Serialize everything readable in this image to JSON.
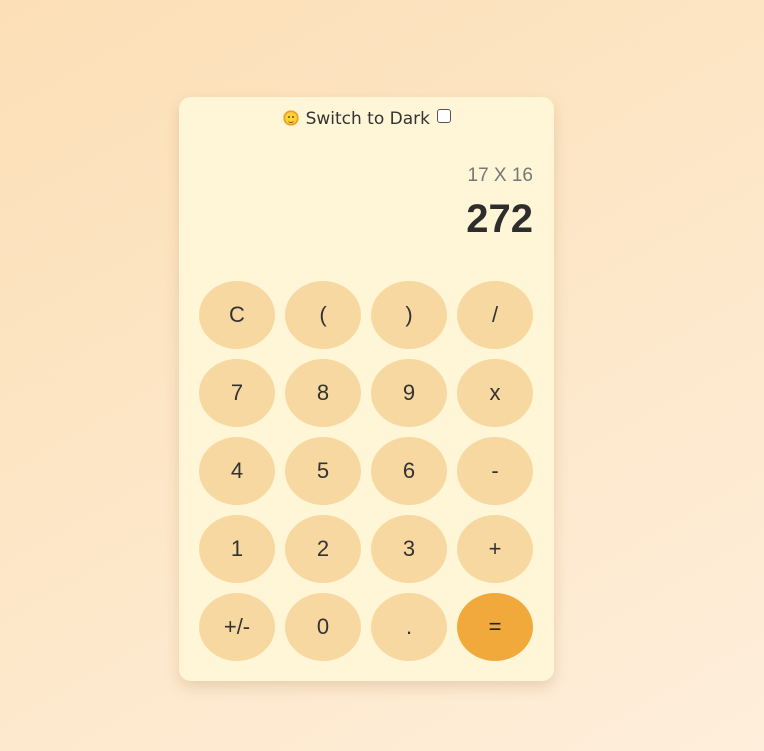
{
  "theme_toggle": {
    "icon": "sun-face-icon",
    "label": "Switch to Dark",
    "checked": false
  },
  "display": {
    "expression": "17 X 16",
    "result": "272"
  },
  "keys": [
    [
      "C",
      "(",
      ")",
      "/"
    ],
    [
      "7",
      "8",
      "9",
      "x"
    ],
    [
      "4",
      "5",
      "6",
      "-"
    ],
    [
      "1",
      "2",
      "3",
      "+"
    ],
    [
      "+/-",
      "0",
      ".",
      "="
    ]
  ],
  "colors": {
    "key_background": "#f7d8a0",
    "equals_background": "#f2a93b",
    "panel_background": "#fff6d8"
  }
}
